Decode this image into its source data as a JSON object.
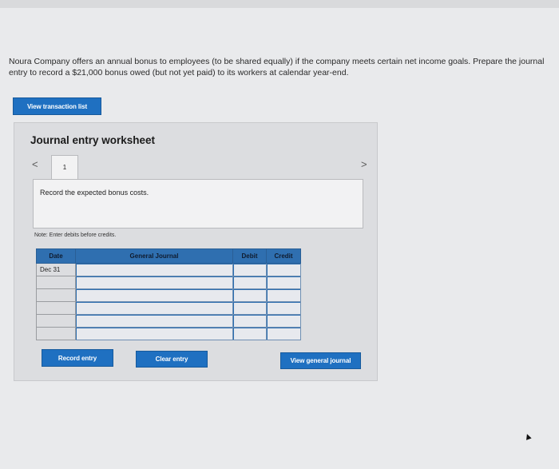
{
  "problem_text": "Noura Company offers an annual bonus to employees (to be shared equally) if the company meets certain net income goals. Prepare the journal entry to record a $21,000 bonus owed (but not yet paid) to its workers at calendar year-end.",
  "buttons": {
    "view_transaction_list": "View transaction list",
    "record_entry": "Record entry",
    "clear_entry": "Clear entry",
    "view_general_journal": "View general journal"
  },
  "worksheet": {
    "title": "Journal entry worksheet",
    "nav_prev": "<",
    "nav_next": ">",
    "tab_label": "1",
    "description": "Record the expected bonus costs.",
    "note": "Note: Enter debits before credits."
  },
  "table": {
    "headers": [
      "Date",
      "General Journal",
      "Debit",
      "Credit"
    ],
    "rows": [
      [
        "Dec 31",
        "",
        "",
        ""
      ],
      [
        "",
        "",
        "",
        ""
      ],
      [
        "",
        "",
        "",
        ""
      ],
      [
        "",
        "",
        "",
        ""
      ],
      [
        "",
        "",
        "",
        ""
      ],
      [
        "",
        "",
        "",
        ""
      ]
    ]
  },
  "colors": {
    "accent": "#1f70c1",
    "table_header": "#2f6fb0"
  }
}
